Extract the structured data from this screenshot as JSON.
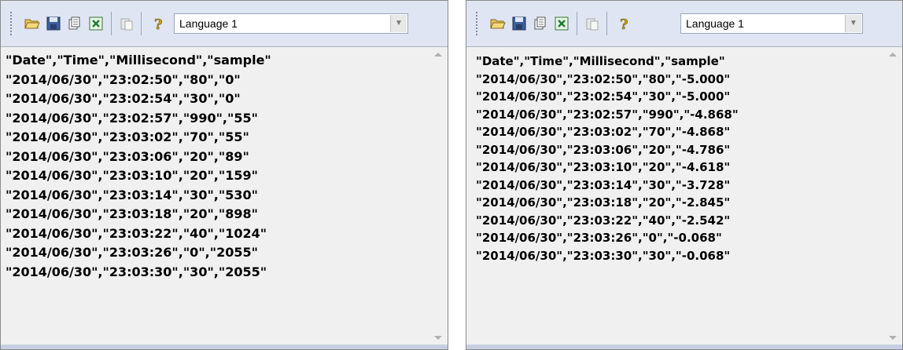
{
  "toolbar_icons": [
    "open-folder-icon",
    "save-icon",
    "copy-pages-icon",
    "excel-export-icon",
    "paste-icon",
    "help-icon"
  ],
  "windows": [
    {
      "language_select": "Language 1",
      "lines": [
        "\"Date\",\"Time\",\"Millisecond\",\"sample\"",
        "\"2014/06/30\",\"23:02:50\",\"80\",\"0\"",
        "\"2014/06/30\",\"23:02:54\",\"30\",\"0\"",
        "\"2014/06/30\",\"23:02:57\",\"990\",\"55\"",
        "\"2014/06/30\",\"23:03:02\",\"70\",\"55\"",
        "\"2014/06/30\",\"23:03:06\",\"20\",\"89\"",
        "\"2014/06/30\",\"23:03:10\",\"20\",\"159\"",
        "\"2014/06/30\",\"23:03:14\",\"30\",\"530\"",
        "\"2014/06/30\",\"23:03:18\",\"20\",\"898\"",
        "\"2014/06/30\",\"23:03:22\",\"40\",\"1024\"",
        "\"2014/06/30\",\"23:03:26\",\"0\",\"2055\"",
        "\"2014/06/30\",\"23:03:30\",\"30\",\"2055\""
      ]
    },
    {
      "language_select": "Language 1",
      "lines": [
        "\"Date\",\"Time\",\"Millisecond\",\"sample\"",
        "\"2014/06/30\",\"23:02:50\",\"80\",\"-5.000\"",
        "\"2014/06/30\",\"23:02:54\",\"30\",\"-5.000\"",
        "\"2014/06/30\",\"23:02:57\",\"990\",\"-4.868\"",
        "\"2014/06/30\",\"23:03:02\",\"70\",\"-4.868\"",
        "\"2014/06/30\",\"23:03:06\",\"20\",\"-4.786\"",
        "\"2014/06/30\",\"23:03:10\",\"20\",\"-4.618\"",
        "\"2014/06/30\",\"23:03:14\",\"30\",\"-3.728\"",
        "\"2014/06/30\",\"23:03:18\",\"20\",\"-2.845\"",
        "\"2014/06/30\",\"23:03:22\",\"40\",\"-2.542\"",
        "\"2014/06/30\",\"23:03:26\",\"0\",\"-0.068\"",
        "\"2014/06/30\",\"23:03:30\",\"30\",\"-0.068\""
      ]
    }
  ]
}
